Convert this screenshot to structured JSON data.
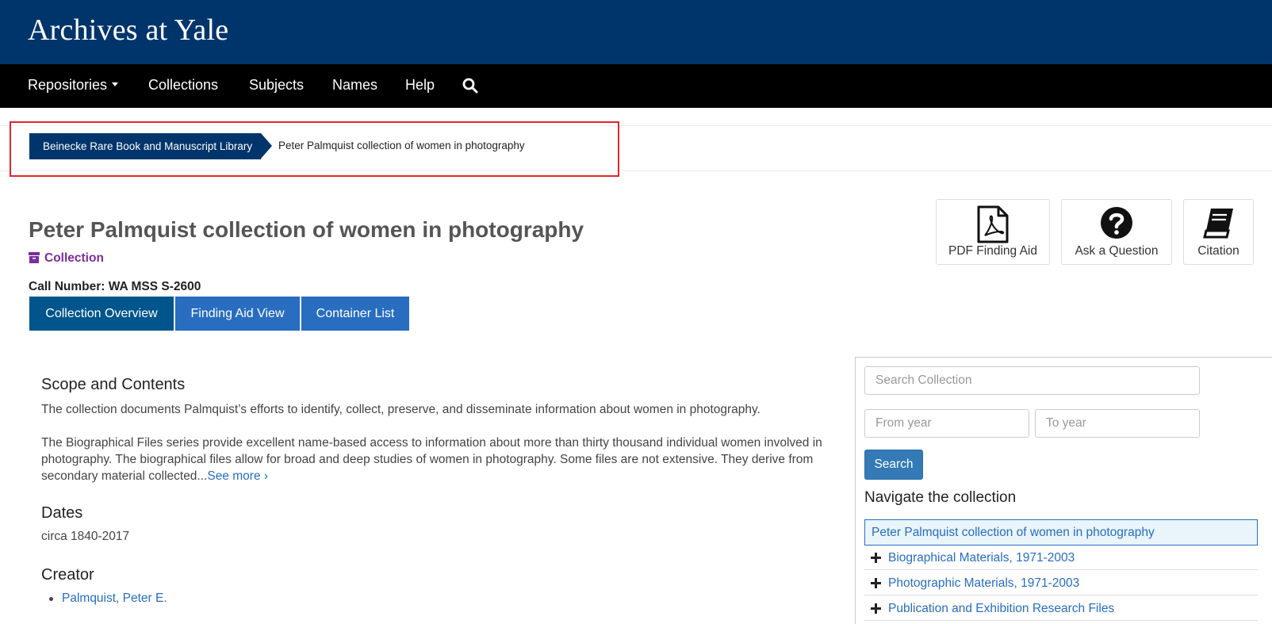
{
  "header": {
    "site_title": "Archives at Yale"
  },
  "nav": {
    "items": [
      "Repositories",
      "Collections",
      "Subjects",
      "Names",
      "Help"
    ],
    "search_icon": "search-icon"
  },
  "breadcrumb": {
    "repository": "Beinecke Rare Book and Manuscript Library",
    "current": "Peter Palmquist collection of women in photography"
  },
  "record": {
    "title": "Peter Palmquist collection of women in photography",
    "type_icon": "archive-box-icon",
    "type": "Collection",
    "call_number_label": "Call Number:",
    "call_number": "WA MSS S-2600"
  },
  "tabs": [
    "Collection Overview",
    "Finding Aid View",
    "Container List"
  ],
  "actions": [
    {
      "label": "PDF Finding Aid",
      "icon": "pdf-icon"
    },
    {
      "label": "Ask a Question",
      "icon": "question-circle-icon"
    },
    {
      "label": "Citation",
      "icon": "book-icon"
    }
  ],
  "content": {
    "scope_heading": "Scope and Contents",
    "scope_p1": "The collection documents Palmquist’s efforts to identify, collect, preserve, and disseminate information about women in photography.",
    "scope_p2": "The Biographical Files series provide excellent name-based access to information about more than thirty thousand individual women involved in photography. The biographical files allow for broad and deep studies of women in photography. Some files are not extensive. They derive from secondary material collected...",
    "see_more": "See more",
    "dates_heading": "Dates",
    "dates_value": "circa 1840-2017",
    "creator_heading": "Creator",
    "creator_value": "Palmquist, Peter E."
  },
  "sidebar": {
    "search_placeholder": "Search Collection",
    "from_placeholder": "From year",
    "to_placeholder": "To year",
    "search_button": "Search",
    "navigate_heading": "Navigate the collection",
    "tree_root": "Peter Palmquist collection of women in photography",
    "tree_items": [
      "Biographical Materials, 1971-2003",
      "Photographic Materials, 1971-2003",
      "Publication and Exhibition Research Files"
    ]
  },
  "colors": {
    "brand_blue": "#00356b",
    "tab_blue": "#286dc0",
    "tab_active": "#00558c",
    "highlight_red": "#e0262d",
    "record_type_purple": "#7b2d9e"
  }
}
